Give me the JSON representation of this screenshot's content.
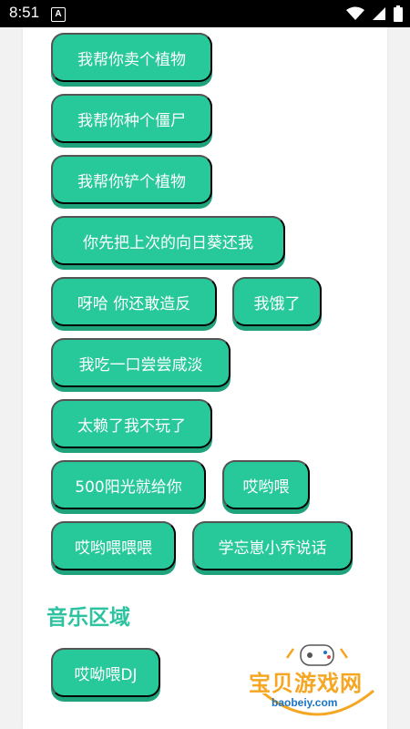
{
  "status_bar": {
    "time": "8:51",
    "notification_icon": "a-letter-icon",
    "icons": [
      "wifi-icon",
      "signal-icon",
      "battery-icon"
    ]
  },
  "buttons": [
    {
      "label": "我帮你卖个植物"
    },
    {
      "label": "我帮你种个僵尸"
    },
    {
      "label": "我帮你铲个植物"
    },
    {
      "label": "你先把上次的向日葵还我"
    },
    {
      "label": "呀哈 你还敢造反"
    },
    {
      "label": "我饿了"
    },
    {
      "label": "我吃一口尝尝咸淡"
    },
    {
      "label": "太赖了我不玩了"
    },
    {
      "label": "500阳光就给你"
    },
    {
      "label": "哎哟喂"
    },
    {
      "label": "哎哟喂喂喂"
    },
    {
      "label": "学忘崽小乔说话"
    }
  ],
  "music_section": {
    "title": "音乐区域",
    "buttons": [
      {
        "label": "哎呦喂DJ"
      }
    ]
  },
  "watermark": {
    "text": "宝贝游戏网",
    "url": "baobeiy.com",
    "icon": "gamepad-icon"
  },
  "colors": {
    "button_bg": "#27c99a",
    "button_shadow": "#1ea37c",
    "section_title": "#2ec3a0"
  }
}
